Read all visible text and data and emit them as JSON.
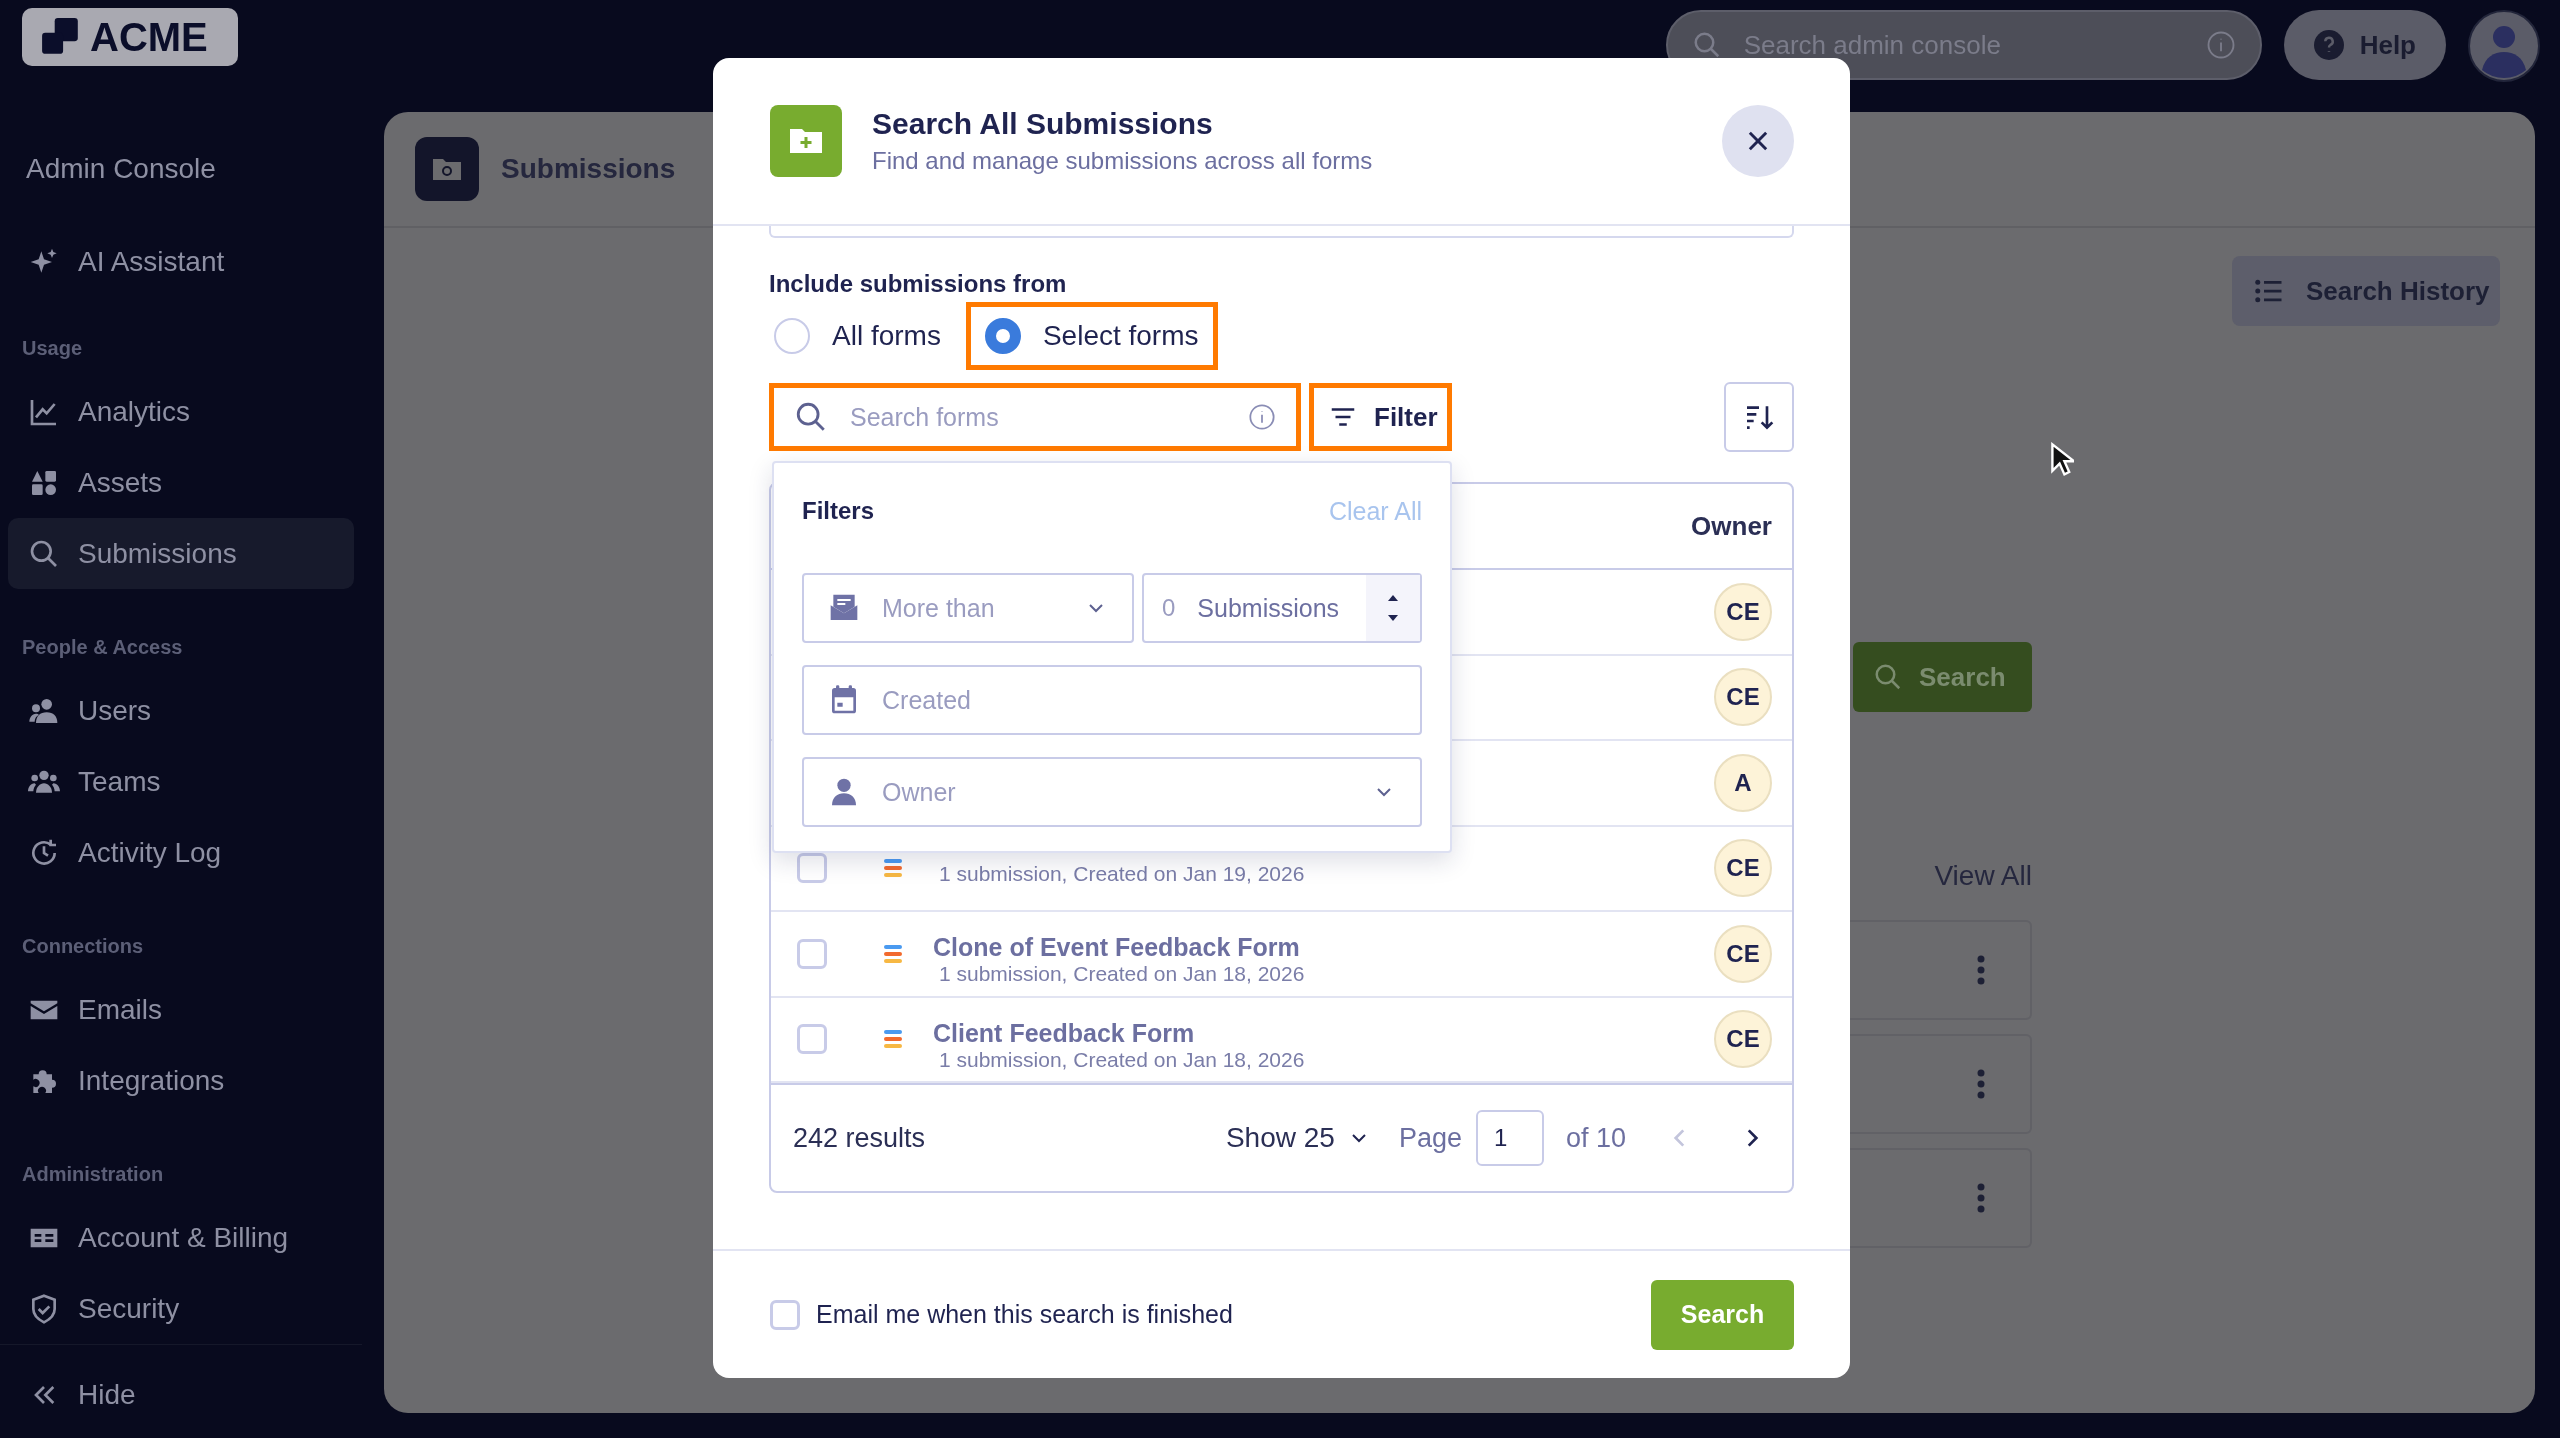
{
  "sidebar": {
    "logo": "ACME",
    "title": "Admin Console",
    "sections": [
      {
        "items": [
          {
            "label": "AI Assistant",
            "selected": false
          }
        ]
      },
      {
        "heading": "Usage",
        "items": [
          {
            "label": "Analytics",
            "selected": false
          },
          {
            "label": "Assets",
            "selected": false
          },
          {
            "label": "Submissions",
            "selected": true
          }
        ]
      },
      {
        "heading": "People & Access",
        "items": [
          {
            "label": "Users",
            "selected": false
          },
          {
            "label": "Teams",
            "selected": false
          },
          {
            "label": "Activity Log",
            "selected": false
          }
        ]
      },
      {
        "heading": "Connections",
        "items": [
          {
            "label": "Emails",
            "selected": false
          },
          {
            "label": "Integrations",
            "selected": false
          }
        ]
      },
      {
        "heading": "Administration",
        "items": [
          {
            "label": "Account & Billing",
            "selected": false
          },
          {
            "label": "Security",
            "selected": false
          }
        ]
      }
    ],
    "hide": "Hide"
  },
  "topbar": {
    "search_placeholder": "Search admin console",
    "help": "Help"
  },
  "page": {
    "title": "Submissions",
    "history_button": "Search History",
    "search_button": "Search",
    "view_all": "View All"
  },
  "modal": {
    "title": "Search All Submissions",
    "subtitle": "Find and manage submissions across all forms",
    "include_label": "Include submissions from",
    "scopes": [
      {
        "label": "All forms",
        "selected": false,
        "highlighted": false
      },
      {
        "label": "Select forms",
        "selected": true,
        "highlighted": true
      }
    ],
    "search": {
      "placeholder": "Search forms",
      "highlighted": true
    },
    "filter_button": {
      "label": "Filter",
      "highlighted": true
    },
    "filters": {
      "title": "Filters",
      "clear": "Clear All",
      "count_mode": "More than",
      "count_value": "0",
      "count_unit": "Submissions",
      "created_placeholder": "Created",
      "owner_placeholder": "Owner"
    },
    "table": {
      "owner_heading": "Owner",
      "rows": [
        {
          "owner": "CE"
        },
        {
          "owner": "CE"
        },
        {
          "owner": "A"
        },
        {
          "checked": false,
          "meta": "1 submission, Created on Jan 19, 2026",
          "owner": "CE"
        },
        {
          "checked": false,
          "title": "Clone of Event Feedback Form",
          "meta": "1 submission, Created on Jan 18, 2026",
          "owner": "CE"
        },
        {
          "checked": false,
          "title": "Client Feedback Form",
          "meta": "1 submission, Created on Jan 18, 2026",
          "owner": "CE"
        }
      ],
      "results": "242 results",
      "page_size": "Show 25",
      "page_label": "Page",
      "page": "1",
      "page_total": "of 10",
      "prev_disabled": true,
      "next_disabled": false
    },
    "email": {
      "label": "Email me when this search is finished",
      "checked": false
    },
    "search_button": "Search"
  }
}
